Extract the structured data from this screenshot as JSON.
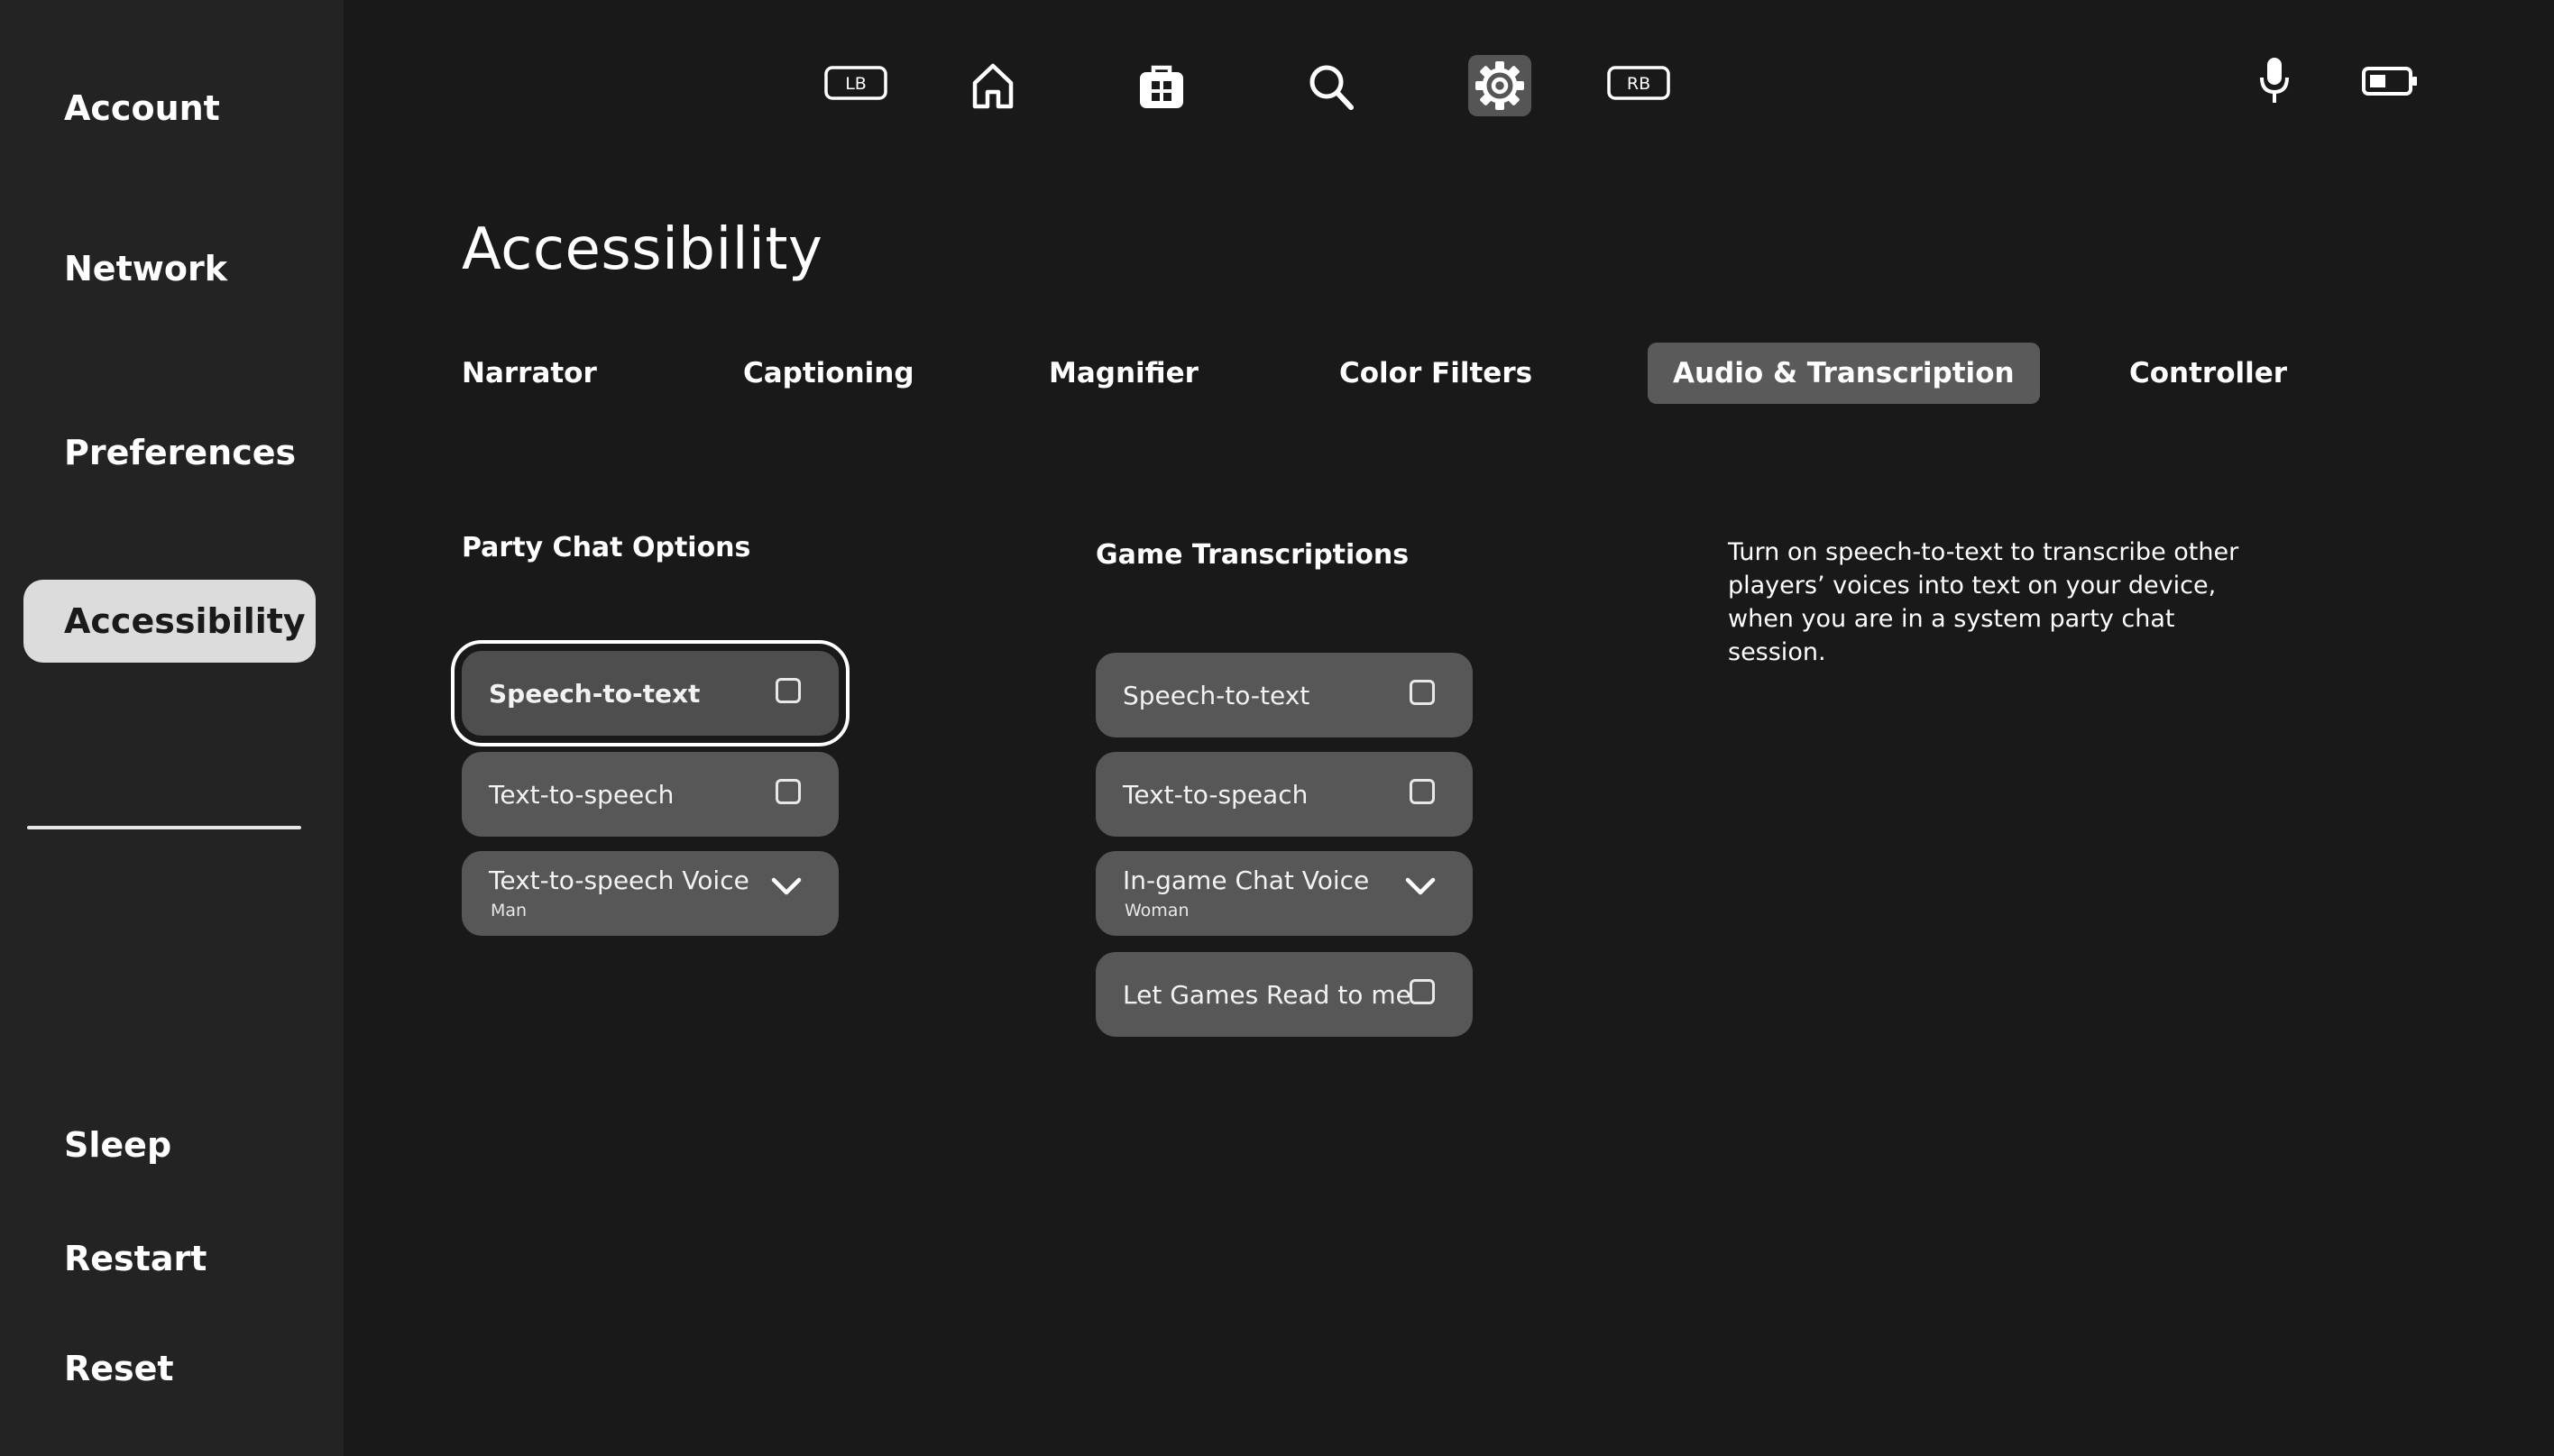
{
  "sidebar": {
    "items": [
      {
        "label": "Account"
      },
      {
        "label": "Network"
      },
      {
        "label": "Preferences"
      },
      {
        "label": "Accessibility"
      },
      {
        "label": "Sleep"
      },
      {
        "label": "Restart"
      },
      {
        "label": "Reset"
      }
    ],
    "active": "Accessibility"
  },
  "topbar": {
    "lb_label": "LB",
    "rb_label": "RB",
    "icons": [
      "lb-button-icon",
      "home-icon",
      "store-icon",
      "search-icon",
      "settings-gear-icon",
      "rb-button-icon",
      "microphone-icon",
      "battery-icon"
    ],
    "active_icon": "settings-gear-icon"
  },
  "page": {
    "title": "Accessibility"
  },
  "tabs": [
    {
      "label": "Narrator"
    },
    {
      "label": "Captioning"
    },
    {
      "label": "Magnifier"
    },
    {
      "label": "Color Filters"
    },
    {
      "label": "Audio & Transcription"
    },
    {
      "label": "Controller"
    }
  ],
  "active_tab": "Audio & Transcription",
  "party_chat": {
    "title": "Party Chat Options",
    "options": [
      {
        "label": "Speech-to-text",
        "type": "checkbox",
        "checked": false
      },
      {
        "label": "Text-to-speech",
        "type": "checkbox",
        "checked": false
      },
      {
        "label": "Text-to-speech Voice",
        "type": "dropdown",
        "value": "Man"
      }
    ]
  },
  "game_transcriptions": {
    "title": "Game Transcriptions",
    "options": [
      {
        "label": "Speech-to-text",
        "type": "checkbox",
        "checked": false
      },
      {
        "label": "Text-to-speach",
        "type": "checkbox",
        "checked": false
      },
      {
        "label": "In-game Chat Voice",
        "type": "dropdown",
        "value": "Woman"
      },
      {
        "label": "Let Games Read to me",
        "type": "checkbox",
        "checked": false
      }
    ]
  },
  "description": "Turn on speech-to-text to transcribe other players’ voices into text on your device, when you are in a system party chat session.",
  "colors": {
    "background": "#191919",
    "sidebar": "#232323",
    "option": "#575757",
    "active_tab": "#5a5a5a",
    "active_sidebar": "#dcdcdc"
  }
}
